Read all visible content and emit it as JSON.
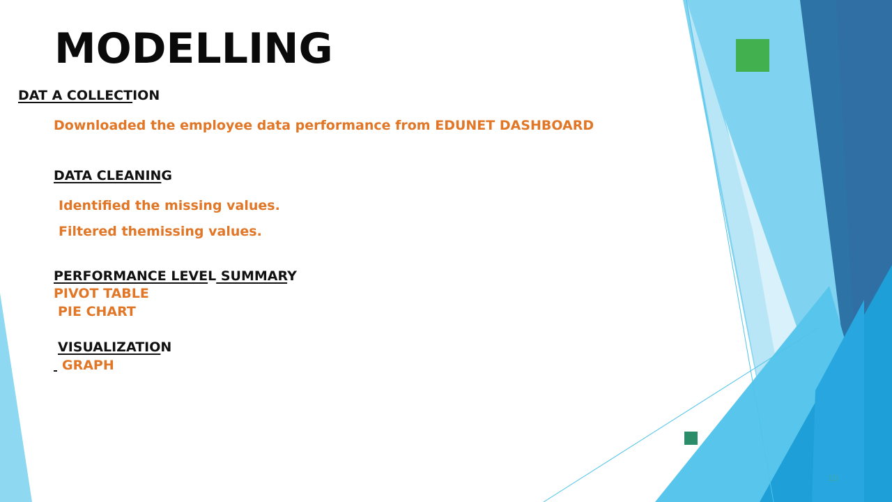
{
  "slide": {
    "title": "MODELLING",
    "section1": {
      "heading_ul": "DAT A COLLECT",
      "heading_rest": "ION",
      "items": [
        "Downloaded the employee data performance from EDUNET DASHBOARD"
      ]
    },
    "section2": {
      "heading_ul": "DATA CLEANIN",
      "heading_rest": "G",
      "items": [
        "Identified the missing values.",
        "Filtered themissing values."
      ]
    },
    "section3": {
      "heading_ul_1": "PERFORMANCE LEVE",
      "heading_mid": "L",
      "heading_ul_2": " SUMMAR",
      "heading_rest": "Y",
      "items": [
        "PIVOT TABLE",
        "PIE CHART"
      ]
    },
    "section4": {
      "heading_ul": "VISUALIZATIO",
      "heading_rest": "N",
      "items": [
        "GRAPH"
      ]
    },
    "page_number": "10"
  },
  "colors": {
    "accent_orange": "#e07626",
    "green_square": "#43b04f",
    "teal_square": "#2b8c69",
    "blue_light": "#7fd3f0",
    "blue_mid": "#2aaadf",
    "blue_dark": "#2d73a6"
  }
}
